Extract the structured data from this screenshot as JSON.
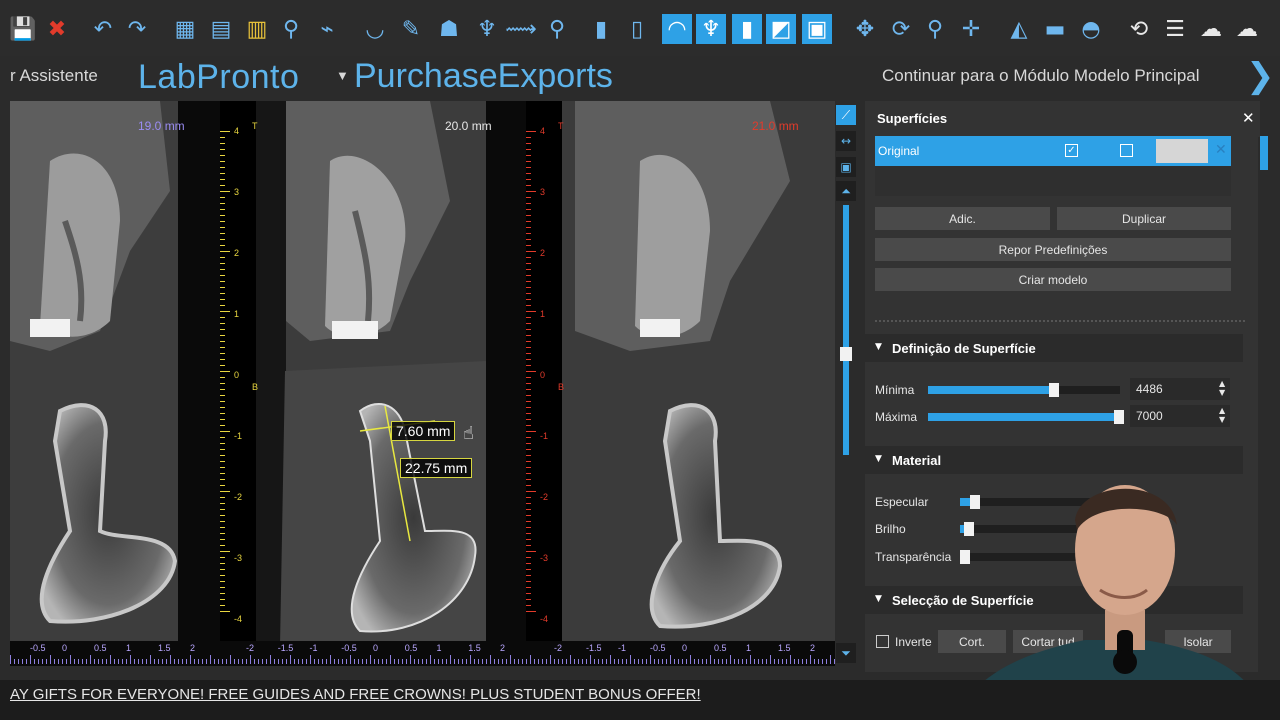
{
  "toolbar": {
    "icons": [
      {
        "name": "save-icon",
        "glyph": "💾"
      },
      {
        "name": "close-project-icon",
        "glyph": "✖"
      },
      {
        "name": "undo-icon",
        "glyph": "↶"
      },
      {
        "name": "redo-icon",
        "glyph": "↷"
      },
      {
        "name": "grid-icon",
        "glyph": "▦"
      },
      {
        "name": "import-icon",
        "glyph": "▤"
      },
      {
        "name": "ruler-book-icon",
        "glyph": "▥"
      },
      {
        "name": "search-icon",
        "glyph": "⚲"
      },
      {
        "name": "curve-tool-icon",
        "glyph": "⌁"
      },
      {
        "name": "arch-icon",
        "glyph": "◡"
      },
      {
        "name": "pen-add-icon",
        "glyph": "✎"
      },
      {
        "name": "denture-icon",
        "glyph": "☗"
      },
      {
        "name": "tooth-icon",
        "glyph": "♆"
      },
      {
        "name": "nerve-icon",
        "glyph": "⟿"
      },
      {
        "name": "implant-add-icon",
        "glyph": "⚲"
      },
      {
        "name": "implant-icon",
        "glyph": "▮"
      },
      {
        "name": "abutment-icon",
        "glyph": "▯"
      },
      {
        "name": "scan-arch-icon",
        "glyph": "◠"
      },
      {
        "name": "crown-icon",
        "glyph": "♆"
      },
      {
        "name": "sleeve-icon",
        "glyph": "▮"
      },
      {
        "name": "model-icon",
        "glyph": "◩"
      },
      {
        "name": "guide-icon",
        "glyph": "▣"
      },
      {
        "name": "move-icon",
        "glyph": "✥"
      },
      {
        "name": "rotate-icon",
        "glyph": "⟳"
      },
      {
        "name": "zoom-icon",
        "glyph": "⚲"
      },
      {
        "name": "pan-icon",
        "glyph": "✛"
      },
      {
        "name": "histogram-icon",
        "glyph": "◭"
      },
      {
        "name": "measure-icon",
        "glyph": "▬"
      },
      {
        "name": "angle-icon",
        "glyph": "◓"
      },
      {
        "name": "reset-view-icon",
        "glyph": "⟲"
      },
      {
        "name": "layout-icon",
        "glyph": "☰"
      },
      {
        "name": "cloud-icon",
        "glyph": "☁"
      },
      {
        "name": "cloud-upload-icon",
        "glyph": "☁"
      }
    ]
  },
  "header": {
    "assistant": "r Assistente",
    "brand_primary": "LabPronto",
    "brand_secondary": "PurchaseExports",
    "continue": "Continuar para o Módulo Modelo Principal"
  },
  "viewer": {
    "slices": [
      {
        "label": "19.0 mm",
        "label_color": "#9a8cf2"
      },
      {
        "label": "20.0 mm",
        "label_color": "#e6e6e6"
      },
      {
        "label": "21.0 mm",
        "label_color": "#e23b2b"
      }
    ],
    "rulers": [
      {
        "color": "#e8d640",
        "top_letter": "T",
        "mid_letter": "B",
        "numbers": [
          "4",
          "3",
          "2",
          "1",
          "0",
          "-1",
          "-2",
          "-3",
          "-4"
        ]
      },
      {
        "color": "#e23b2b",
        "top_letter": "T",
        "mid_letter": "B",
        "numbers": [
          "4",
          "3",
          "2",
          "1",
          "0",
          "-1",
          "-2",
          "-3",
          "-4"
        ]
      }
    ],
    "hscale_groups": [
      [
        "-0.5",
        "0",
        "0.5",
        "1",
        "1.5",
        "2"
      ],
      [
        "-2",
        "-1.5",
        "-1",
        "-0.5",
        "0",
        "0.5",
        "1",
        "1.5",
        "2"
      ],
      [
        "-2",
        "-1.5",
        "-1",
        "-0.5",
        "0",
        "0.5",
        "1",
        "1.5",
        "2"
      ]
    ],
    "measurements": {
      "width": "7.60 mm",
      "length": "22.75 mm"
    }
  },
  "panel": {
    "title": "Superfícies",
    "surface": {
      "name": "Original",
      "visible": true,
      "solid": false,
      "color": "#d6d6d6"
    },
    "buttons": {
      "add": "Adic.",
      "duplicate": "Duplicar",
      "reset": "Repor Predefinições",
      "create": "Criar modelo"
    },
    "definition": {
      "heading": "Definição de Superfície",
      "min_label": "Mínima",
      "min_value": "4486",
      "min_fraction": 0.66,
      "max_label": "Máxima",
      "max_value": "7000",
      "max_fraction": 1.0
    },
    "material": {
      "heading": "Material",
      "specular_label": "Especular",
      "specular_fraction": 0.1,
      "brightness_label": "Brilho",
      "brightness_fraction": 0.06,
      "transparency_label": "Transparência",
      "transparency_fraction": 0.0
    },
    "selection": {
      "heading": "Selecção de Superfície",
      "invert_label": "Inverte",
      "cut_label": "Cort.",
      "cut_all_label": "Cortar tud",
      "isolate_label": "Isolar"
    }
  },
  "banner": {
    "text": "AY GIFTS FOR EVERYONE! FREE GUIDES AND FREE CROWNS! PLUS STUDENT BONUS OFFER!"
  }
}
